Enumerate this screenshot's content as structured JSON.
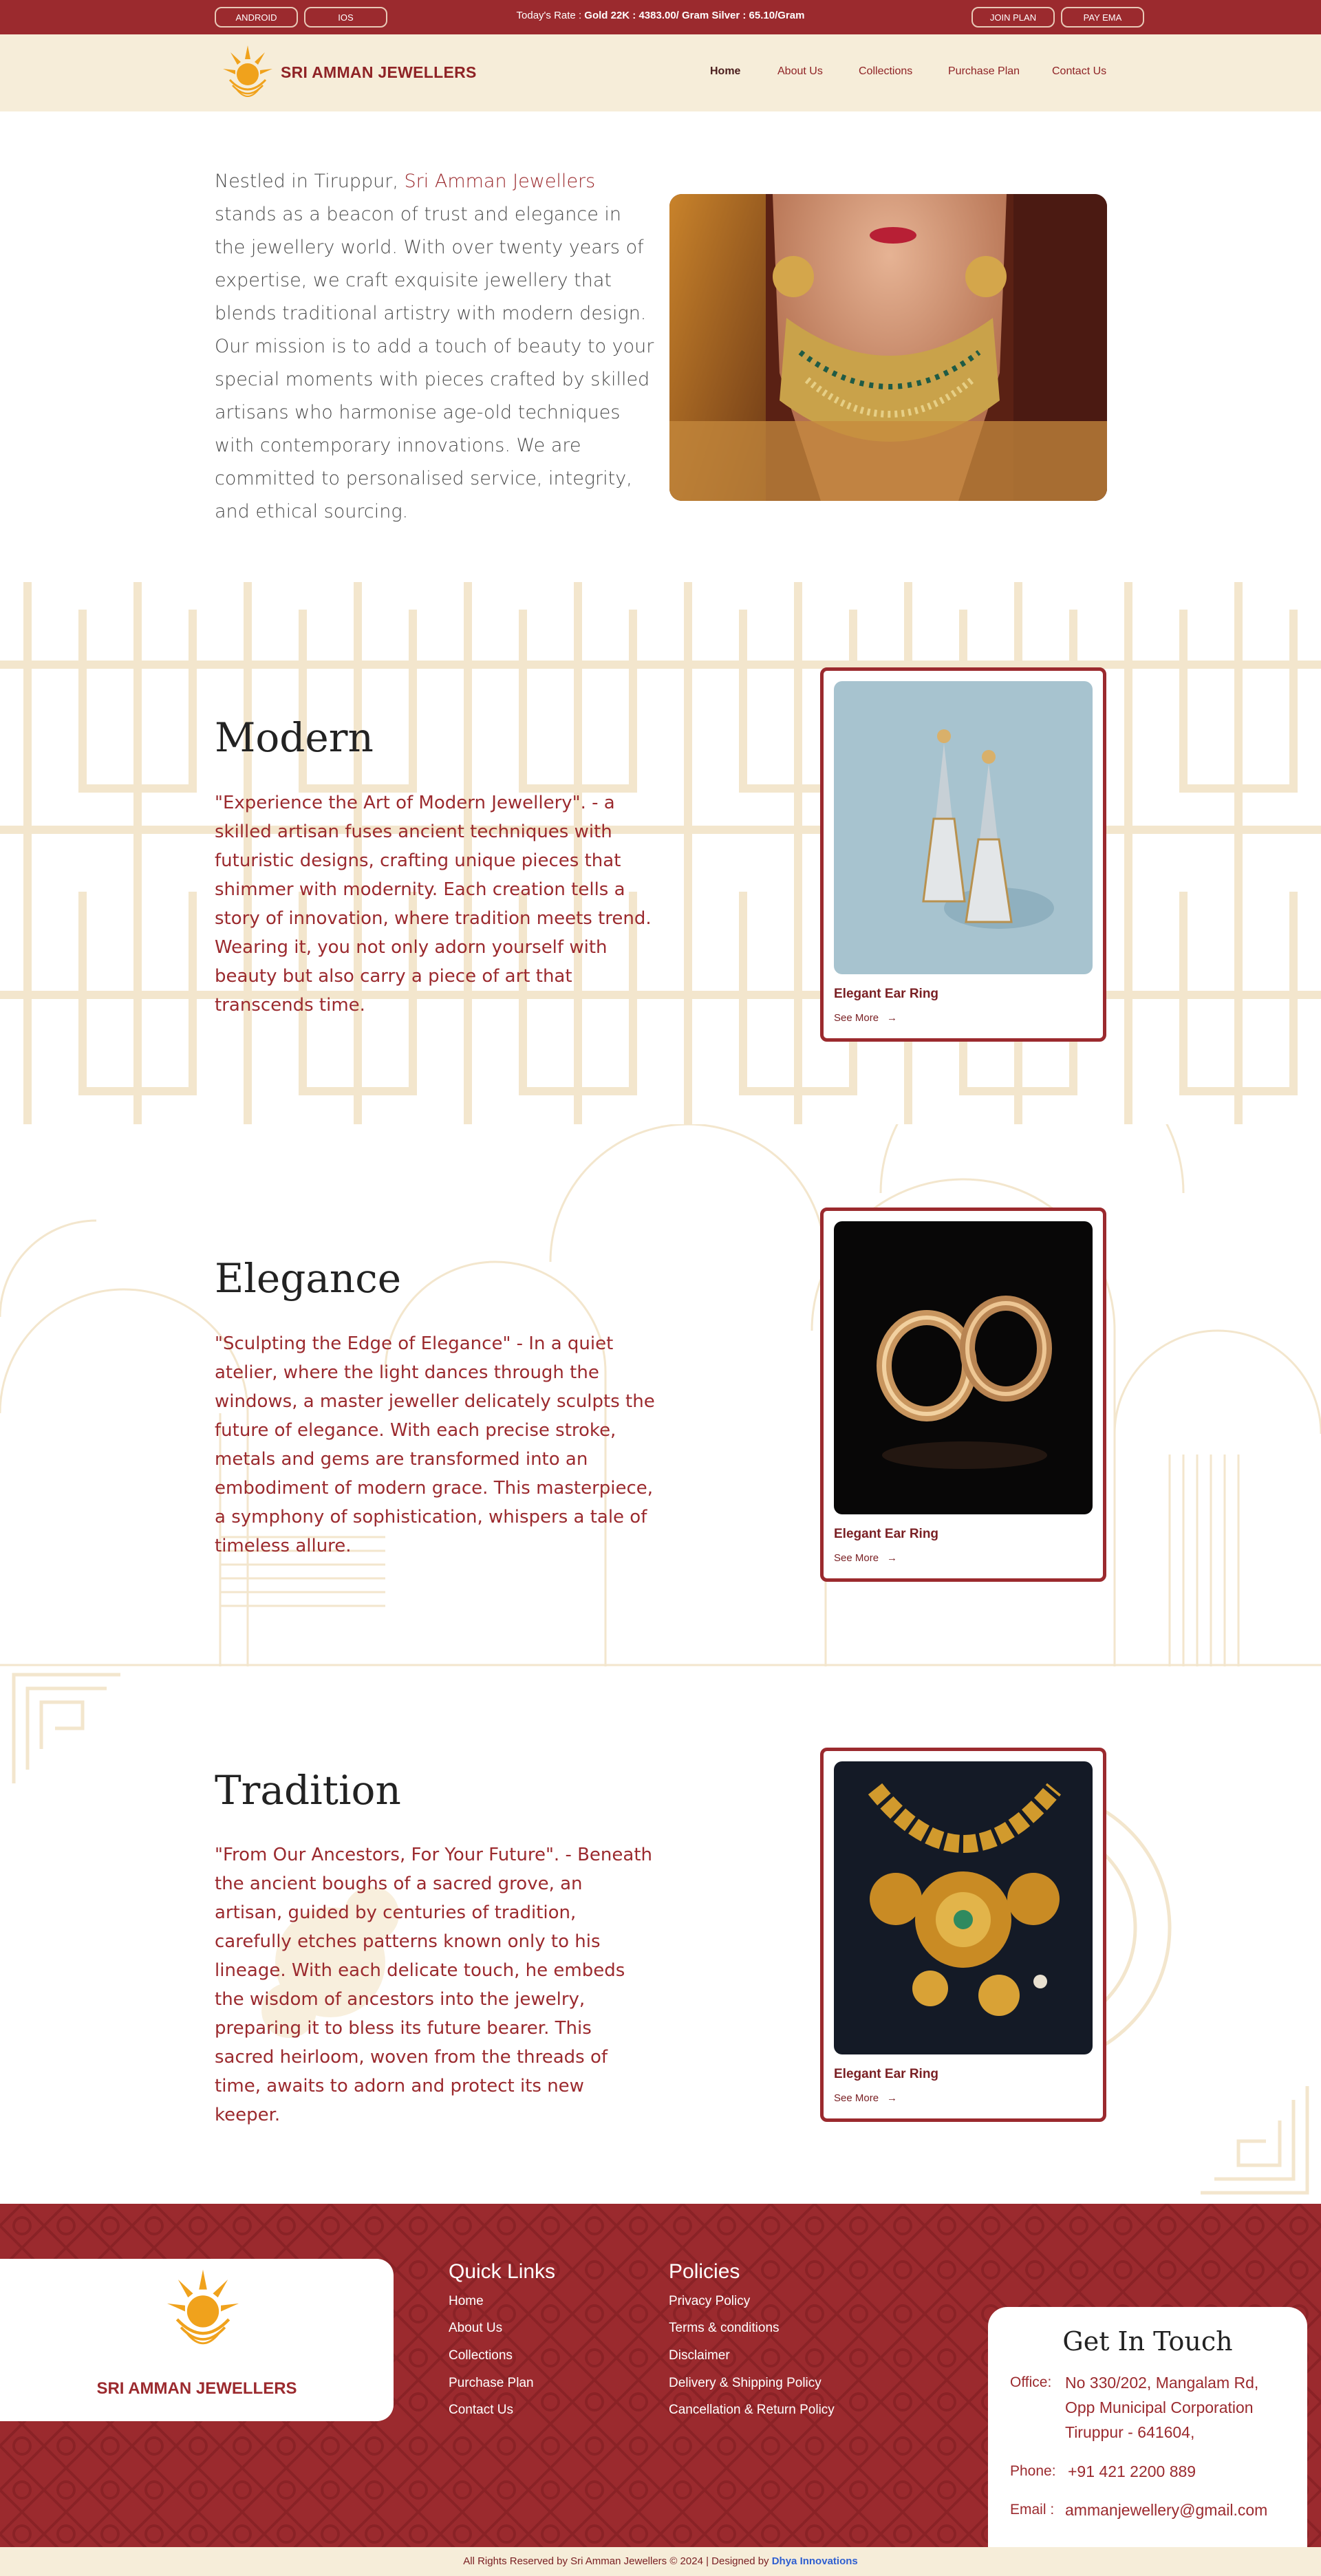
{
  "topbar": {
    "android_label": "ANDROID",
    "ios_label": "IOS",
    "rate_prefix": "Today's Rate : ",
    "rate_value": "Gold 22K : 4383.00/ Gram Silver : 65.10/Gram",
    "join_label": "JOIN PLAN",
    "pay_label": "PAY EMA"
  },
  "header": {
    "brand": "SRI AMMAN JEWELLERS",
    "nav": [
      "Home",
      "About Us",
      "Collections",
      "Purchase Plan",
      "Contact Us"
    ]
  },
  "intro": {
    "before": "Nestled in Tiruppur, ",
    "highlight": "Sri Amman Jewellers",
    "after": " stands as a beacon of trust and elegance in the jewellery world. With over twenty years of expertise, we craft exquisite jewellery that blends traditional artistry with modern design. Our mission is to add a touch of beauty to your special moments with pieces crafted by skilled artisans who harmonise age-old techniques with contemporary innovations. We are committed to personalised service, integrity, and ethical sourcing."
  },
  "sections": [
    {
      "title": "Modern",
      "text": "\"Experience the Art of Modern Jewellery\". - a skilled artisan fuses ancient techniques with futuristic designs, crafting unique pieces that shimmer with modernity. Each creation tells a story of innovation, where tradition meets trend. Wearing it, you not only adorn yourself with beauty but also carry a piece of art that transcends time.",
      "card_title": "Elegant Ear Ring",
      "card_link": "See More"
    },
    {
      "title": "Elegance",
      "text": "\"Sculpting the Edge of Elegance\" - In a quiet atelier, where the light dances through the windows, a master jeweller delicately sculpts the future of elegance. With each precise stroke, metals and gems are transformed into an embodiment of modern grace. This masterpiece, a symphony of sophistication, whispers a tale of timeless allure.",
      "card_title": "Elegant Ear Ring",
      "card_link": "See More"
    },
    {
      "title": "Tradition",
      "text": "\"From Our Ancestors, For Your Future\". - Beneath the ancient boughs of a sacred grove, an artisan, guided by centuries of tradition, carefully etches patterns known only to his lineage. With each delicate touch, he embeds the wisdom of ancestors into the jewelry, preparing it to bless its future bearer. This sacred heirloom, woven from the threads of time, awaits to adorn and protect its new keeper.",
      "card_title": "Elegant Ear Ring",
      "card_link": "See More"
    }
  ],
  "footer": {
    "brand": "SRI AMMAN JEWELLERS",
    "quick_links_title": "Quick Links",
    "quick_links": [
      "Home",
      "About Us",
      "Collections",
      "Purchase Plan",
      "Contact Us"
    ],
    "policies_title": "Policies",
    "policies": [
      "Privacy Policy",
      "Terms & conditions",
      "Disclaimer",
      "Delivery & Shipping Policy",
      "Cancellation & Return Policy"
    ],
    "contact_title": "Get In Touch",
    "office_label": "Office:",
    "office_lines": [
      "No 330/202, Mangalam Rd,",
      "Opp Municipal Corporation",
      "Tiruppur - 641604,"
    ],
    "phone_label": "Phone:",
    "phone": "+91 421 2200 889",
    "email_label": "Email :",
    "email": "ammanjewellery@gmail.com",
    "copyright": "All Rights Reserved by Sri Amman Jewellers © 2024 | Designed by ",
    "designer": "Dhya Innovations"
  },
  "colors": {
    "maroon": "#9b2a2e",
    "cream": "#f6edd9",
    "gold": "#f0a21c"
  }
}
